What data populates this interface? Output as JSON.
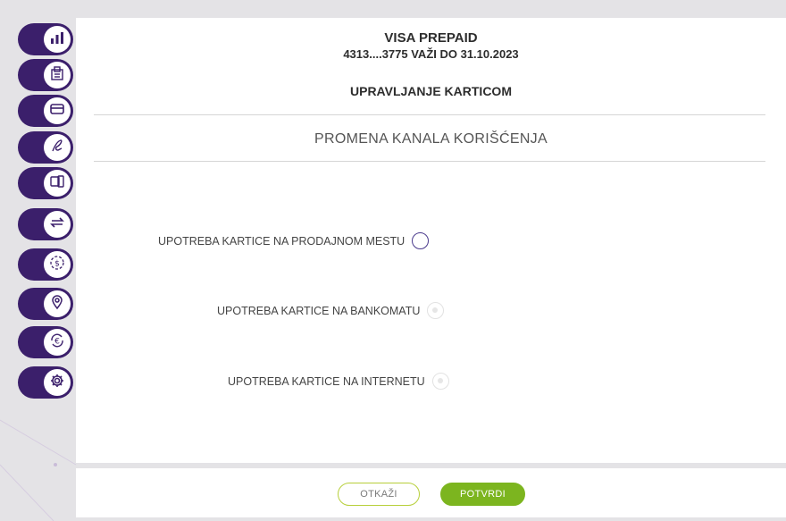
{
  "card": {
    "name": "VISA PREPAID",
    "number_line": "4313....3775 VAŽI DO 31.10.2023"
  },
  "section_title": "UPRAVLJANJE KARTICOM",
  "sub_title": "PROMENA KANALA KORIŠĆENJA",
  "options": [
    {
      "label": "UPOTREBA KARTICE NA PRODAJNOM MESTU",
      "state": "enabled"
    },
    {
      "label": "UPOTREBA KARTICE NA BANKOMATU",
      "state": "disabled"
    },
    {
      "label": "UPOTREBA KARTICE NA INTERNETU",
      "state": "disabled"
    }
  ],
  "buttons": {
    "cancel": "OTKAŽI",
    "confirm": "POTVRDI"
  },
  "sidebar": {
    "items": [
      {
        "icon": "bar-chart-icon"
      },
      {
        "icon": "documents-icon"
      },
      {
        "icon": "card-icon"
      },
      {
        "icon": "signature-icon"
      },
      {
        "icon": "devices-icon"
      },
      {
        "icon": "transfer-icon"
      },
      {
        "icon": "dollar-cycle-icon"
      },
      {
        "icon": "location-pin-icon"
      },
      {
        "icon": "euro-exchange-icon"
      },
      {
        "icon": "gear-icon"
      }
    ]
  },
  "colors": {
    "sidebar": "#3b1f6b",
    "accent_green": "#7cb51f",
    "radio_border": "#4a3a8c"
  }
}
